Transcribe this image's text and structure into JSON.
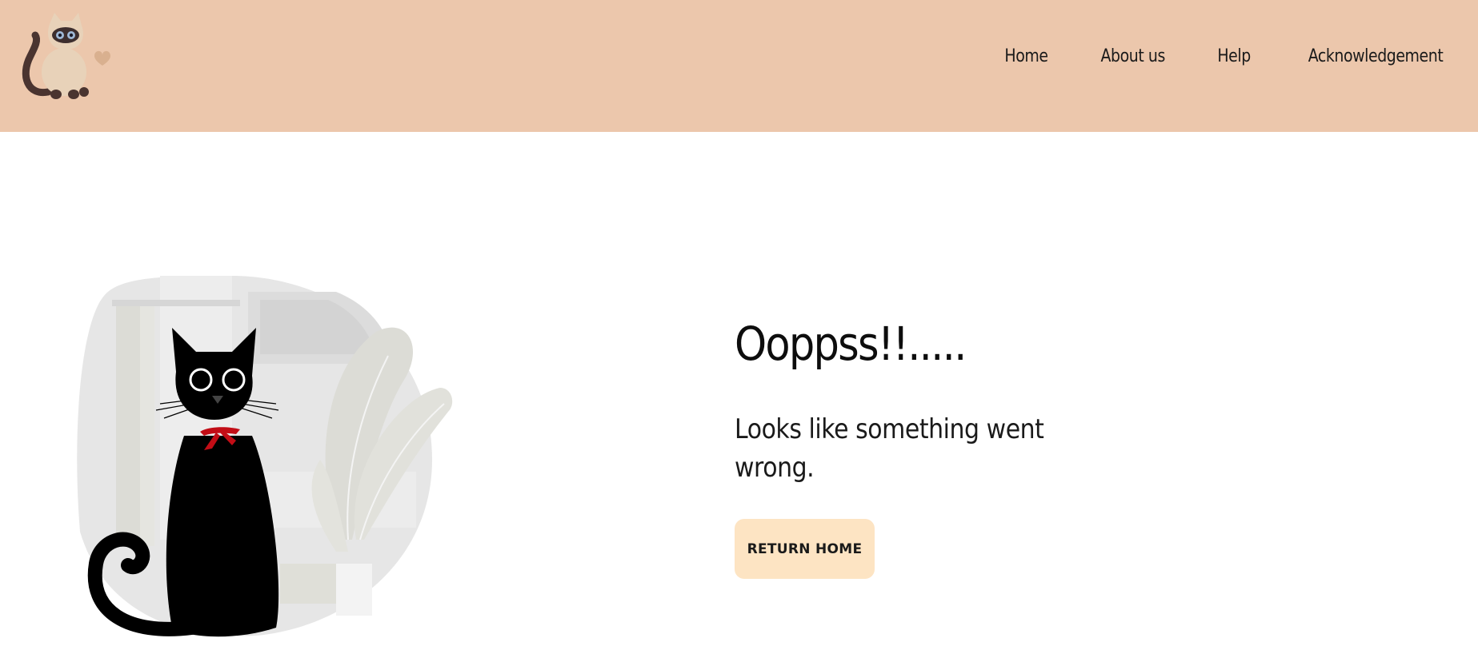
{
  "header": {
    "logo_icon": "siamese-cat-logo-icon",
    "nav": [
      {
        "label": "Home"
      },
      {
        "label": "About us"
      },
      {
        "label": "Help"
      },
      {
        "label": "Acknowledgement"
      }
    ],
    "background_color": "#ecc7ac"
  },
  "main": {
    "illustration_icon": "black-cat-illustration",
    "headline": "Ooppss!!.....",
    "message": "Looks like something went wrong.",
    "button_label": "RETURN HOME",
    "button_color": "#fde4c3"
  }
}
